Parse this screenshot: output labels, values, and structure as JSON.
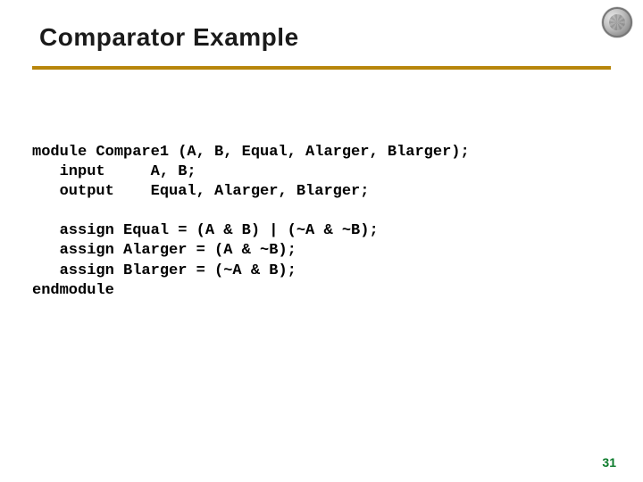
{
  "title": "Comparator Example",
  "code": {
    "l1": "module Compare1 (A, B, Equal, Alarger, Blarger);",
    "l2": "   input     A, B;",
    "l3": "   output    Equal, Alarger, Blarger;",
    "l4": "",
    "l5": "   assign Equal = (A & B) | (~A & ~B);",
    "l6": "   assign Alarger = (A & ~B);",
    "l7": "   assign Blarger = (~A & B);",
    "l8": "endmodule"
  },
  "page_number": "31"
}
